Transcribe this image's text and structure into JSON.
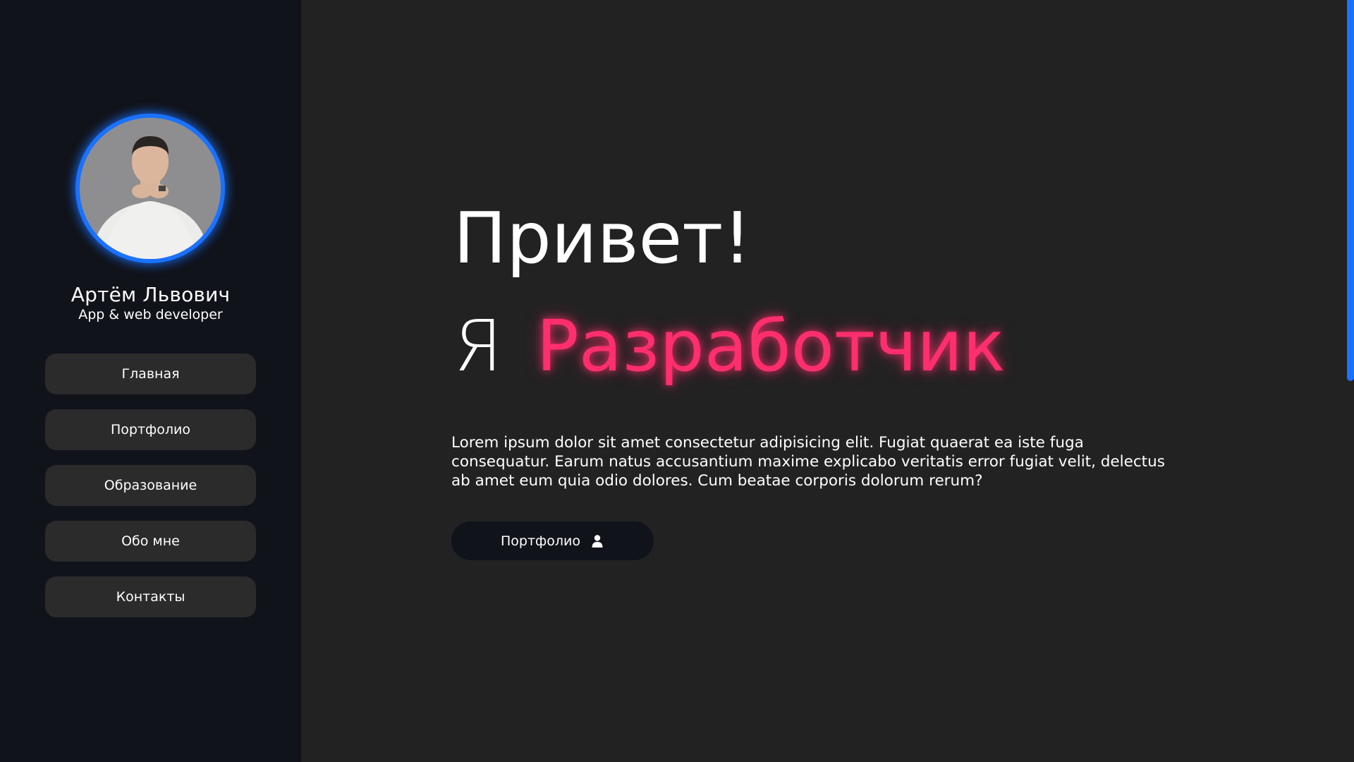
{
  "sidebar": {
    "profile": {
      "name": "Артём Львович",
      "role": "App & web developer",
      "avatar_icon": "profile-photo"
    },
    "nav_items": [
      {
        "label": "Главная"
      },
      {
        "label": "Портфолио"
      },
      {
        "label": "Образование"
      },
      {
        "label": "Обо мне"
      },
      {
        "label": "Контакты"
      }
    ]
  },
  "hero": {
    "greeting": "Привет!",
    "prefix": "Я",
    "role": "Разработчик",
    "description": "Lorem ipsum dolor sit amet consectetur adipisicing elit. Fugiat quaerat ea iste fuga consequatur. Earum natus accusantium maxime explicabo veritatis error fugiat velit, delectus ab amet eum quia odio dolores. Cum beatae corporis dolorum rerum?",
    "cta": {
      "label": "Портфолио",
      "icon": "user-icon"
    }
  },
  "scrollbar": {
    "position": 0.5
  },
  "colors": {
    "sidebar_bg": "#11131a",
    "main_bg": "#222223",
    "accent_blue": "#1a72ff",
    "accent_pink": "#ff2e6c",
    "nav_item_bg": "#2b2b2c",
    "cta_bg": "#10131a"
  }
}
